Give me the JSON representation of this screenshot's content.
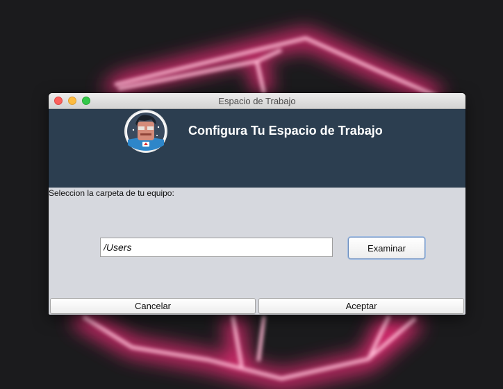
{
  "window": {
    "title": "Espacio de Trabajo",
    "header_title": "Configura Tu Espacio de Trabajo",
    "avatar_icon": "cartoon-developer-avatar-icon",
    "prompt": "Seleccion la carpeta de tu equipo:"
  },
  "path_field": {
    "value": "/Users"
  },
  "buttons": {
    "browse": "Examinar",
    "cancel": "Cancelar",
    "accept": "Aceptar"
  },
  "colors": {
    "banner": "#2c3e50",
    "dialog_body": "#d6d8de",
    "backdrop": "#1b1b1d",
    "neon_glow": "#ff3d8b"
  }
}
